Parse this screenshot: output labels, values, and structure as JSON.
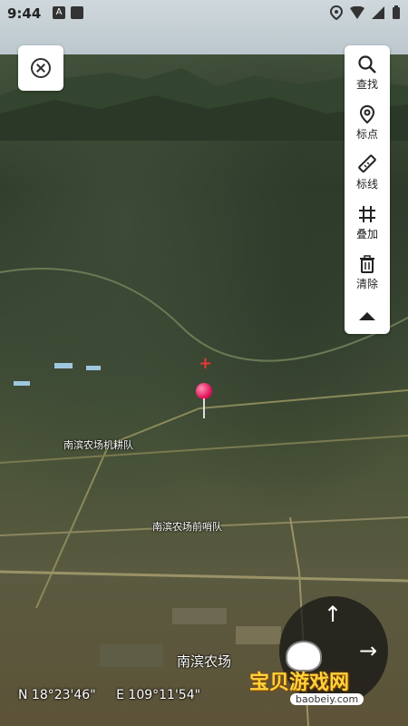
{
  "status_bar": {
    "time": "9:44"
  },
  "toolbar": {
    "search_label": "查找",
    "marker_label": "标点",
    "line_label": "标线",
    "overlay_label": "叠加",
    "clear_label": "清除"
  },
  "map": {
    "labels": {
      "label_1": "南滨农场机耕队",
      "label_2": "南滨农场前哨队",
      "label_3": "南滨农场"
    }
  },
  "coordinates": {
    "latitude": "N 18°23'46\"",
    "longitude": "E 109°11'54\""
  },
  "watermark": {
    "text": "宝贝游戏网",
    "url": "baobeiy.com"
  },
  "colors": {
    "pin": "#e0185c",
    "crosshair": "#e53935",
    "watermark": "#ffd23c"
  }
}
